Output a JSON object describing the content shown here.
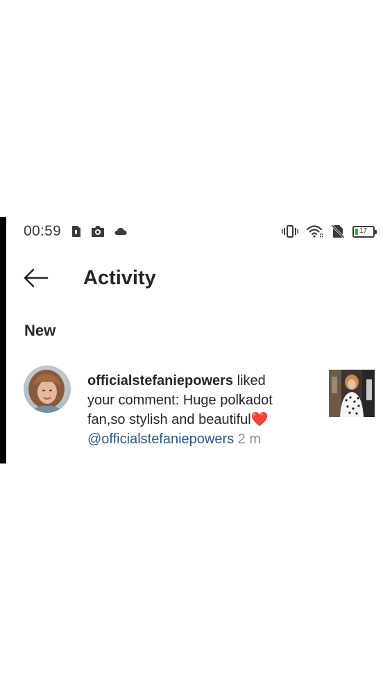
{
  "status_bar": {
    "time": "00:59",
    "left_icons": [
      "sim-card-icon",
      "camera-icon",
      "cloud-icon"
    ],
    "right_icons": [
      "vibrate-icon",
      "wifi-icon",
      "no-sim-icon",
      "battery-icon"
    ],
    "battery_level": "17",
    "battery_charging": true
  },
  "header": {
    "back_icon": "arrow-left-icon",
    "title": "Activity"
  },
  "section": {
    "title": "New"
  },
  "activity": [
    {
      "username": "officialstefaniepowers",
      "action": " liked your comment: Huge polkadot fan,so stylish and beautiful",
      "emoji": "❤️",
      "mention": "@officialstefaniepowers",
      "time": "2 m"
    }
  ],
  "colors": {
    "text": "#262626",
    "mention": "#2b5a82",
    "timestamp": "#8e8e8e",
    "heart": "#e0102a",
    "battery_charge": "#2bb34a"
  }
}
